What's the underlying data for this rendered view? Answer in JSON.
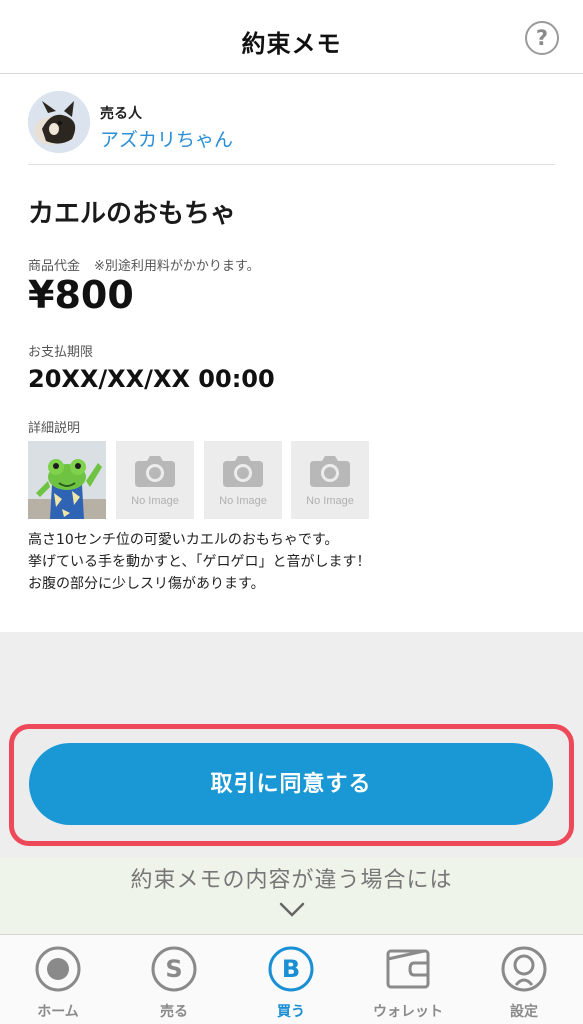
{
  "header": {
    "title": "約束メモ",
    "help_icon": "question-circle-icon",
    "help_glyph": "?"
  },
  "seller": {
    "role": "売る人",
    "name": "アズカリちゃん"
  },
  "item": {
    "title": "カエルのおもちゃ",
    "price_label": "商品代金",
    "price_note": "※別途利用料がかかります。",
    "price": "¥800",
    "deadline_label": "お支払期限",
    "deadline": "20XX/XX/XX 00:00",
    "description_label": "詳細説明",
    "no_image_text": "No Image",
    "description_lines": [
      "高さ10センチ位の可愛いカエルのおもちゃです。",
      "挙げている手を動かすと、「ゲロゲロ」と音がします！",
      "お腹の部分に少しスリ傷があります。"
    ]
  },
  "actions": {
    "agree_label": "取引に同意する",
    "different_label": "約束メモの内容が違う場合には"
  },
  "tabbar": {
    "active": "買う",
    "items": [
      {
        "label": "ホーム",
        "icon": "home-icon"
      },
      {
        "label": "売る",
        "icon": "sell-icon",
        "glyph": "S"
      },
      {
        "label": "買う",
        "icon": "buy-icon",
        "glyph": "B"
      },
      {
        "label": "ウォレット",
        "icon": "wallet-icon"
      },
      {
        "label": "設定",
        "icon": "settings-icon"
      }
    ]
  },
  "colors": {
    "accent": "#1a98d5",
    "highlight": "#ee4958",
    "link": "#2a8fd6"
  }
}
